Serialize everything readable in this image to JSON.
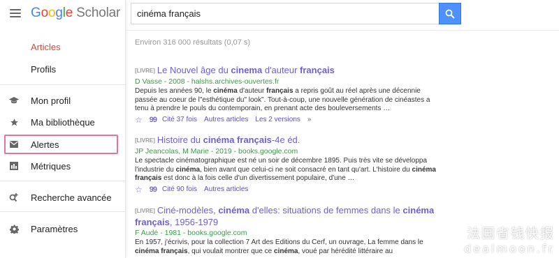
{
  "app": {
    "logo_google": [
      "G",
      "o",
      "o",
      "g",
      "l",
      "e"
    ],
    "logo_scholar": "Scholar",
    "icons": {
      "menu": "hamburger-icon",
      "search": "search-icon"
    }
  },
  "search": {
    "query": "cinéma français",
    "button_color": "#4d90fe"
  },
  "sidebar": {
    "articles": "Articles",
    "profils": "Profils",
    "items": [
      {
        "label": "Mon profil",
        "icon": "graduation-cap-icon"
      },
      {
        "label": "Ma bibliothèque",
        "icon": "star-icon"
      },
      {
        "label": "Alertes",
        "icon": "envelope-icon"
      },
      {
        "label": "Métriques",
        "icon": "metrics-icon"
      },
      {
        "label": "Recherche avancée",
        "icon": "advanced-search-icon"
      },
      {
        "label": "Paramètres",
        "icon": "settings-gear-icon"
      }
    ],
    "active_color": "#d14836",
    "highlight_color": "#e8739a"
  },
  "stats": "Environ 316 000 résultats (0,07 s)",
  "results": [
    {
      "type": "[LIVRE]",
      "title_parts": [
        "Le Nouvel âge du ",
        "cinema",
        " d'auteur ",
        "français",
        ""
      ],
      "meta": "D Vasse - 2008 - halshs.archives-ouvertes.fr",
      "snippet": [
        "Depuis les années 90, le ",
        "cinéma",
        " d'auteur ",
        "français",
        " a repris goût au réel après une décennie passée au coeur de l\"esthétique du\" look\". Tout-à-coup, une nouvelle génération de cinéastes a tenu à prendre le pouls du contemporain, en prenant acte des bouleversements …"
      ],
      "cite": "Cité 37 fois",
      "related": "Autres articles",
      "versions": "Les 2 versions"
    },
    {
      "type": "[LIVRE]",
      "title_parts": [
        "Histoire du ",
        "cinéma français",
        "-4e éd.",
        "",
        ""
      ],
      "meta": "JP Jeancolas, M Marie - 2019 - books.google.com",
      "snippet": [
        "Le spectacle cinématographique est né un soir de décembre 1895. Puis très vite se développa l'industrie du ",
        "cinéma",
        ", bien avant que celui-ci ne soit consacré en tant qu'art. L'histoire du ",
        "cinéma français",
        " est donc à la fois celle d'un divertissement populaire, d'une …"
      ],
      "cite": "Cité 90 fois",
      "related": "Autres articles"
    },
    {
      "type": "[LIVRE]",
      "title_parts": [
        "Ciné-modèles, ",
        "cinéma",
        " d'elles: situations de femmes dans le ",
        "cinéma français",
        ", 1956-1979"
      ],
      "meta": "F Audé - 1981 - books.google.com",
      "snippet": [
        "En 1957, j'écrivis, pour la collection 7 Art des Editions du Cerf, un ouvrage, La femme dans le ",
        "cinéma français",
        ", qui voulait montrer que ce ",
        "cinéma",
        ", voué par hérédité littéraire au"
      ]
    }
  ],
  "watermark": {
    "line1": "法国省钱快报",
    "line2": "dealmoon.fr"
  }
}
